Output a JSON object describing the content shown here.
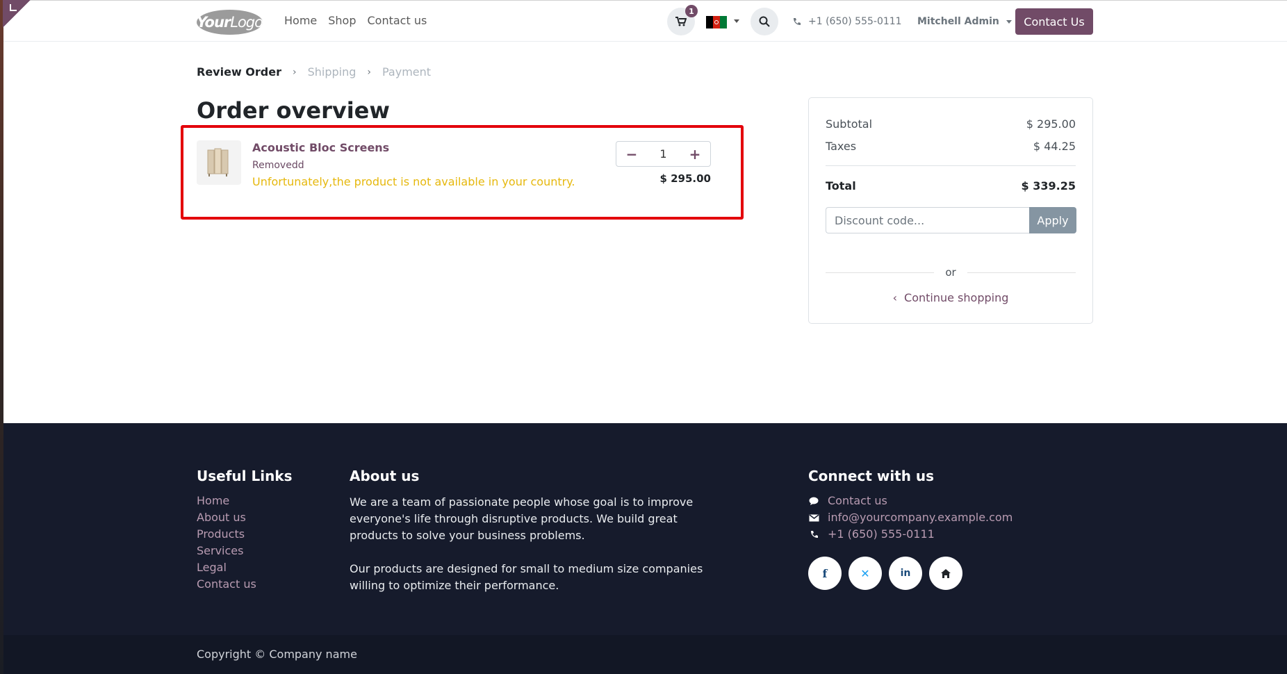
{
  "header": {
    "logo_text_bold": "Your",
    "logo_text_light": "Logo",
    "nav": [
      "Home",
      "Shop",
      "Contact us"
    ],
    "cart_count": "1",
    "phone": "+1 (650) 555-0111",
    "user": "Mitchell Admin",
    "contact_button": "Contact Us"
  },
  "checkout_steps": [
    "Review Order",
    "Shipping",
    "Payment"
  ],
  "page_title": "Order overview",
  "order_line": {
    "product_name": "Acoustic Bloc Screens",
    "variant": "Removedd",
    "warning": "Unfortunately,the product is not available in your country.",
    "quantity": "1",
    "price": "$ 295.00"
  },
  "summary": {
    "subtotal_label": "Subtotal",
    "subtotal_value": "$ 295.00",
    "taxes_label": "Taxes",
    "taxes_value": "$ 44.25",
    "total_label": "Total",
    "total_value": "$ 339.25",
    "discount_placeholder": "Discount code...",
    "apply_label": "Apply",
    "or_label": "or",
    "continue_label": "Continue shopping"
  },
  "footer": {
    "useful_links_title": "Useful Links",
    "useful_links": [
      "Home",
      "About us",
      "Products",
      "Services",
      "Legal",
      "Contact us"
    ],
    "about_title": "About us",
    "about_p1": "We are a team of passionate people whose goal is to improve everyone's life through disruptive products. We build great products to solve your business problems.",
    "about_p2": "Our products are designed for small to medium size companies willing to optimize their performance.",
    "connect_title": "Connect with us",
    "connect_contact": "Contact us",
    "connect_email": "info@yourcompany.example.com",
    "connect_phone": "+1 (650) 555-0111",
    "copyright": "Copyright © Company name"
  },
  "colors": {
    "brand": "#714b67",
    "warning": "#e6b80d",
    "highlight_border": "#e3000b",
    "footer_bg": "#161b2c"
  }
}
